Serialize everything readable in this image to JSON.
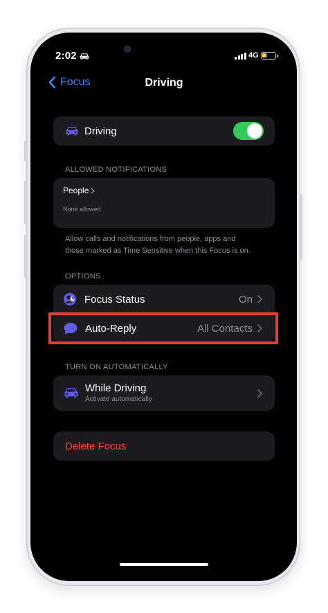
{
  "status_bar": {
    "time": "2:02",
    "network": "4G",
    "battery_level": 0.4
  },
  "nav": {
    "back_label": "Focus",
    "title": "Driving"
  },
  "driving_toggle": {
    "label": "Driving",
    "enabled": true
  },
  "allowed_notifications": {
    "header": "ALLOWED NOTIFICATIONS",
    "people_label": "People",
    "people_value": "None allowed",
    "footnote_line1": "Allow calls and notifications from people, apps and",
    "footnote_line2": "those marked as Time Sensitive when this Focus is on."
  },
  "options": {
    "header": "OPTIONS",
    "focus_status_label": "Focus Status",
    "focus_status_value": "On",
    "auto_reply_label": "Auto-Reply",
    "auto_reply_value": "All Contacts"
  },
  "turn_on": {
    "header": "TURN ON AUTOMATICALLY",
    "title": "While Driving",
    "subtitle": "Activate automatically"
  },
  "delete_label": "Delete Focus",
  "colors": {
    "accent_blue": "#3d8bff",
    "toggle_green": "#34c759",
    "icon_purple": "#5e5ce6",
    "destructive_red": "#ff453a",
    "highlight_red": "#e0403a"
  }
}
